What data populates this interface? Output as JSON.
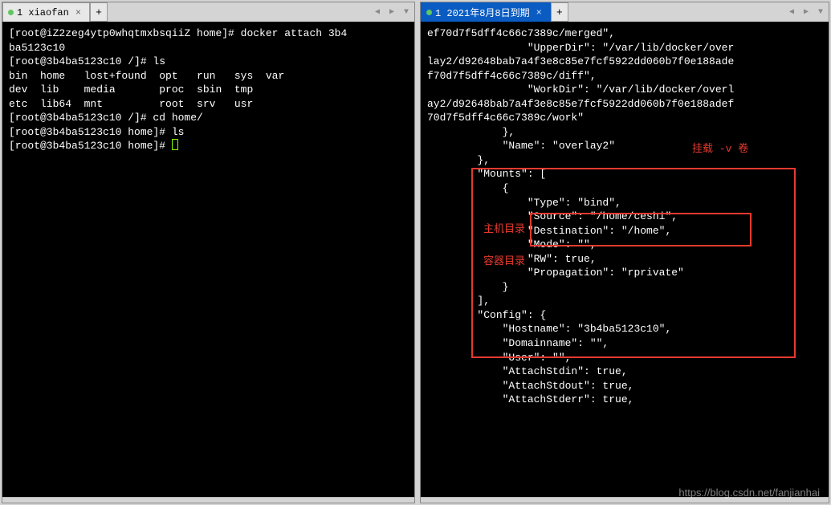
{
  "left": {
    "tab_label": "1 xiaofan",
    "lines": [
      "[root@iZ2zeg4ytp0whqtmxbsqiiZ home]# docker attach 3b4",
      "ba5123c10",
      "[root@3b4ba5123c10 /]# ls",
      "bin  home   lost+found  opt   run   sys  var",
      "dev  lib    media       proc  sbin  tmp",
      "etc  lib64  mnt         root  srv   usr",
      "[root@3b4ba5123c10 /]# cd home/",
      "[root@3b4ba5123c10 home]# ls",
      "[root@3b4ba5123c10 home]# "
    ]
  },
  "right": {
    "tab_label": "1 2021年8月8日到期",
    "lines": [
      "ef70d7f5dff4c66c7389c/merged\",",
      "                \"UpperDir\": \"/var/lib/docker/over",
      "lay2/d92648bab7a4f3e8c85e7fcf5922dd060b7f0e188ade",
      "f70d7f5dff4c66c7389c/diff\",",
      "                \"WorkDir\": \"/var/lib/docker/overl",
      "ay2/d92648bab7a4f3e8c85e7fcf5922dd060b7f0e188adef",
      "70d7f5dff4c66c7389c/work\"",
      "            },",
      "            \"Name\": \"overlay2\"",
      "        },",
      "        \"Mounts\": [",
      "            {",
      "                \"Type\": \"bind\",",
      "                \"Source\": \"/home/ceshi\",",
      "                \"Destination\": \"/home\",",
      "                \"Mode\": \"\",",
      "                \"RW\": true,",
      "                \"Propagation\": \"rprivate\"",
      "            }",
      "        ],",
      "        \"Config\": {",
      "            \"Hostname\": \"3b4ba5123c10\",",
      "            \"Domainname\": \"\",",
      "            \"User\": \"\",",
      "            \"AttachStdin\": true,",
      "            \"AttachStdout\": true,",
      "            \"AttachStderr\": true,"
    ],
    "annotations": {
      "mount_label": "挂载 -v 卷",
      "host_dir": "主机目录",
      "container_dir": "容器目录"
    }
  },
  "glyphs": {
    "close": "×",
    "add": "+",
    "nav_left": "◀",
    "nav_right": "▶",
    "nav_down": "▼"
  },
  "watermark": "https://blog.csdn.net/fanjianhai"
}
